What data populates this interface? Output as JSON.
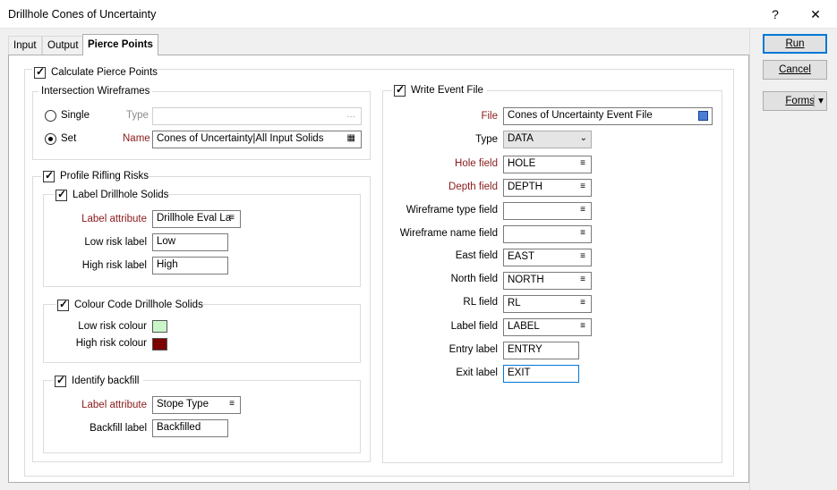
{
  "window": {
    "title": "Drillhole Cones of Uncertainty",
    "help_label": "?",
    "close_label": "✕"
  },
  "tabs": [
    {
      "label": "Input"
    },
    {
      "label": "Output"
    },
    {
      "label": "Pierce Points"
    }
  ],
  "pierce": {
    "calculate_label": "Calculate Pierce Points",
    "intersection": {
      "title": "Intersection Wireframes",
      "single_label": "Single",
      "set_label": "Set",
      "type_label": "Type",
      "type_value": "",
      "name_label": "Name",
      "name_value": "Cones of Uncertainty|All Input Solids",
      "selected": "Set"
    },
    "profile": {
      "title": "Profile Rifling Risks",
      "label_solids": {
        "title": "Label Drillhole Solids",
        "attr_label": "Label attribute",
        "attr_value": "Drillhole Eval La",
        "low_label": "Low risk label",
        "low_value": "Low",
        "high_label": "High risk label",
        "high_value": "High"
      },
      "colour": {
        "title": "Colour Code Drillhole Solids",
        "low_label": "Low risk colour",
        "low_color": "#c9f5c9",
        "high_label": "High risk colour",
        "high_color": "#7b0000"
      },
      "backfill": {
        "title": "Identify backfill",
        "attr_label": "Label attribute",
        "attr_value": "Stope Type",
        "backfill_label": "Backfill label",
        "backfill_value": "Backfilled"
      }
    },
    "event": {
      "title": "Write Event File",
      "file_label": "File",
      "file_value": "Cones of Uncertainty Event File",
      "type_label": "Type",
      "type_value": "DATA",
      "hole_label": "Hole field",
      "hole_value": "HOLE",
      "depth_label": "Depth field",
      "depth_value": "DEPTH",
      "wftype_label": "Wireframe type field",
      "wftype_value": "",
      "wfname_label": "Wireframe name field",
      "wfname_value": "",
      "east_label": "East field",
      "east_value": "EAST",
      "north_label": "North field",
      "north_value": "NORTH",
      "rl_label": "RL field",
      "rl_value": "RL",
      "labelf_label": "Label field",
      "labelf_value": "LABEL",
      "entry_label": "Entry label",
      "entry_value": "ENTRY",
      "exit_label": "Exit label",
      "exit_value": "EXIT"
    }
  },
  "buttons": {
    "run": "Run",
    "cancel": "Cancel",
    "forms": "Forms"
  },
  "icons": {
    "list": "≡",
    "ellipsis": "…",
    "table": "▦",
    "chevron": "⌄",
    "dropdown": "▾"
  }
}
